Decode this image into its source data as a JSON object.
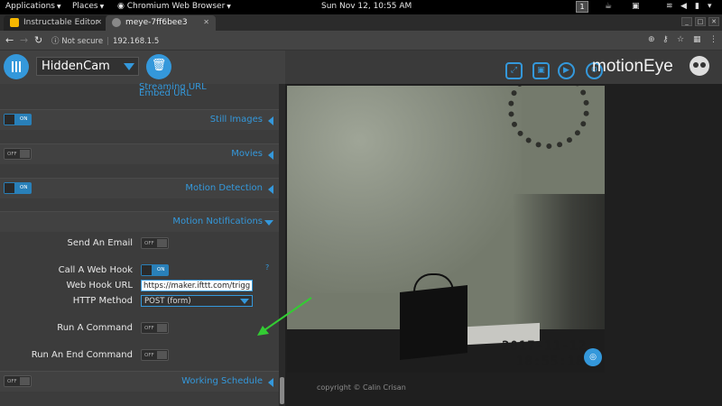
{
  "topbar": {
    "applications": "Applications",
    "places": "Places",
    "browser": "Chromium Web Browser",
    "clock": "Sun Nov 12, 10:55 AM",
    "workspace": "1"
  },
  "tabs": [
    {
      "label": "Instructable Editor",
      "favicon_color": "#f5b700"
    },
    {
      "label": "meye-7ff6bee3",
      "favicon_color": "#888888"
    }
  ],
  "omnibox": {
    "security": "Not secure",
    "url": "192.168.1.5"
  },
  "header": {
    "camera": "HiddenCam",
    "brand": "motionEye"
  },
  "links": {
    "streaming": "Streaming URL",
    "embed": "Embed URL"
  },
  "sections": {
    "still_images": "Still Images",
    "movies": "Movies",
    "motion_detection": "Motion Detection",
    "motion_notifications": "Motion Notifications",
    "working_schedule": "Working Schedule"
  },
  "toggles": {
    "still_images": "ON",
    "movies": "OFF",
    "motion_detection": "ON",
    "send_email": "OFF",
    "web_hook": "ON",
    "run_command": "OFF",
    "run_end_command": "OFF",
    "working_schedule": "OFF"
  },
  "notifications": {
    "send_email_label": "Send An Email",
    "web_hook_label": "Call A Web Hook",
    "web_hook_help": "?",
    "web_hook_url_label": "Web Hook URL",
    "web_hook_url_value": "https://maker.ifttt.com/trigg",
    "http_method_label": "HTTP Method",
    "http_method_value": "POST (form)",
    "run_command_label": "Run A Command",
    "run_end_command_label": "Run An End Command"
  },
  "camera": {
    "date": "2017-11-12",
    "time": "18:55:18"
  },
  "footer": {
    "copyright": "copyright © Calin Crisan"
  },
  "colors": {
    "accent": "#3498db",
    "annotation_arrow": "#33cc33"
  }
}
